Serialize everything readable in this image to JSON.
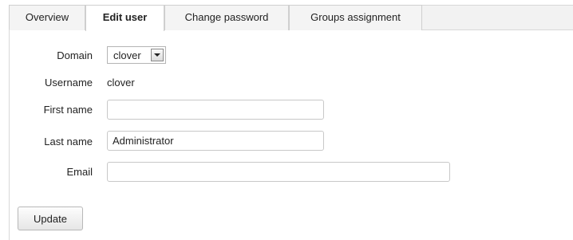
{
  "tabs": [
    {
      "label": "Overview",
      "active": false
    },
    {
      "label": "Edit user",
      "active": true
    },
    {
      "label": "Change password",
      "active": false
    },
    {
      "label": "Groups assignment",
      "active": false
    }
  ],
  "form": {
    "domain": {
      "label": "Domain",
      "value": "clover"
    },
    "username": {
      "label": "Username",
      "value": "clover"
    },
    "first_name": {
      "label": "First name",
      "value": ""
    },
    "last_name": {
      "label": "Last name",
      "value": "Administrator"
    },
    "email": {
      "label": "Email",
      "value": ""
    }
  },
  "actions": {
    "update_label": "Update"
  },
  "icons": {
    "domain_dropdown": "chevron-down-icon"
  },
  "colors": {
    "tabbar_background": "#f2f2f2",
    "active_tab_background": "#ffffff",
    "border": "#cfcfcf"
  }
}
